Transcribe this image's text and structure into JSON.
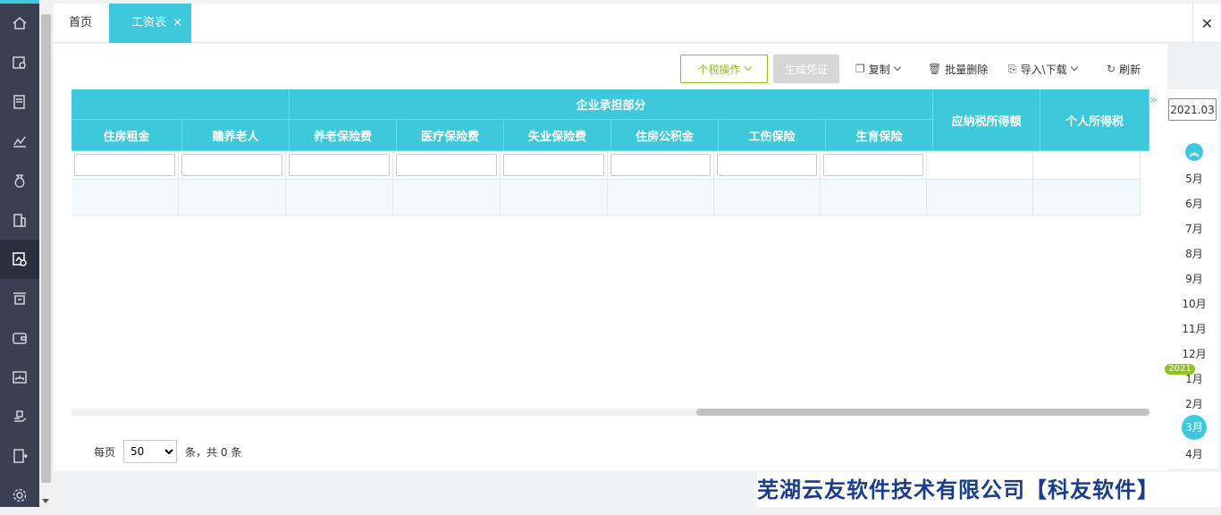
{
  "tabs": {
    "home_label": "首页",
    "active_label": "工资表",
    "active_close": "×",
    "close_all": "✕"
  },
  "toolbar": {
    "tax_ops": "个税操作",
    "generate_voucher": "生成凭证",
    "copy": "复制",
    "batch_delete": "批量删除",
    "import_download": "导入\\下载",
    "refresh": "刷新"
  },
  "grid": {
    "group_header": "企业承担部分",
    "columns": [
      "住房租金",
      "赡养老人",
      "养老保险费",
      "医疗保险费",
      "失业保险费",
      "住房公积金",
      "工伤保险",
      "生育保险"
    ],
    "right_columns": [
      "应纳税所得额",
      "个人所得税"
    ]
  },
  "pager": {
    "per_page_label": "每页",
    "per_page_value": "50",
    "total_text": "条，共 0 条"
  },
  "date_panel": {
    "current": "2021.03",
    "year_tag": "2021",
    "months_before": [
      "5月",
      "6月",
      "7月",
      "8月",
      "9月",
      "10月",
      "11月",
      "12月"
    ],
    "months_after": [
      "1月",
      "2月"
    ],
    "active_month": "3月",
    "next_month": "4月"
  },
  "watermark": "芜湖云友软件技术有限公司【科友软件】",
  "colors": {
    "accent": "#3ec8dc",
    "sidebar": "#3a3f51",
    "green": "#8fc31f",
    "watermark": "#1a3c8c"
  }
}
